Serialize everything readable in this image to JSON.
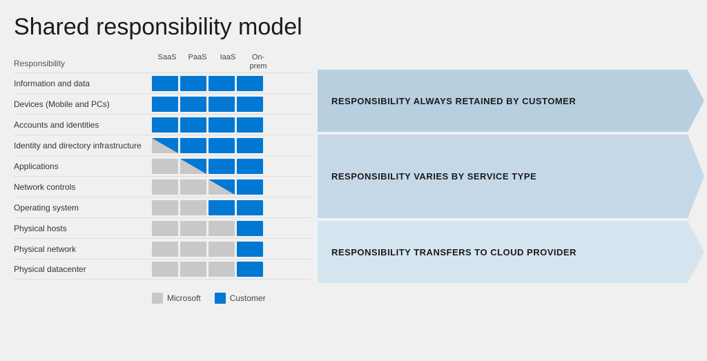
{
  "title": "Shared responsibility model",
  "columns": [
    "SaaS",
    "PaaS",
    "IaaS",
    "On-\nprem"
  ],
  "header_label": "Responsibility",
  "rows": [
    {
      "label": "Information and data",
      "cells": [
        "blue",
        "blue",
        "blue",
        "blue"
      ]
    },
    {
      "label": "Devices (Mobile and PCs)",
      "cells": [
        "blue",
        "blue",
        "blue",
        "blue"
      ]
    },
    {
      "label": "Accounts and identities",
      "cells": [
        "blue",
        "blue",
        "blue",
        "blue"
      ]
    },
    {
      "label": "Identity and directory infrastructure",
      "cells": [
        "diag",
        "blue",
        "blue",
        "blue"
      ]
    },
    {
      "label": "Applications",
      "cells": [
        "gray",
        "diag",
        "blue",
        "blue"
      ]
    },
    {
      "label": "Network controls",
      "cells": [
        "gray",
        "gray",
        "diag",
        "blue"
      ]
    },
    {
      "label": "Operating system",
      "cells": [
        "gray",
        "gray",
        "blue",
        "blue"
      ]
    },
    {
      "label": "Physical hosts",
      "cells": [
        "gray",
        "gray",
        "gray",
        "blue"
      ]
    },
    {
      "label": "Physical network",
      "cells": [
        "gray",
        "gray",
        "gray",
        "blue"
      ]
    },
    {
      "label": "Physical datacenter",
      "cells": [
        "gray",
        "gray",
        "gray",
        "blue"
      ]
    }
  ],
  "arrows": [
    {
      "label": "RESPONSIBILITY ALWAYS RETAINED BY CUSTOMER",
      "row_span": 3,
      "color": "#b8d4e8"
    },
    {
      "label": "RESPONSIBILITY VARIES BY SERVICE TYPE",
      "row_span": 4,
      "color": "#c8dce8"
    },
    {
      "label": "RESPONSIBILITY TRANSFERS TO CLOUD PROVIDER",
      "row_span": 3,
      "color": "#d8e8f0"
    }
  ],
  "legend": {
    "items": [
      {
        "label": "Microsoft",
        "color": "gray"
      },
      {
        "label": "Customer",
        "color": "blue"
      }
    ]
  }
}
